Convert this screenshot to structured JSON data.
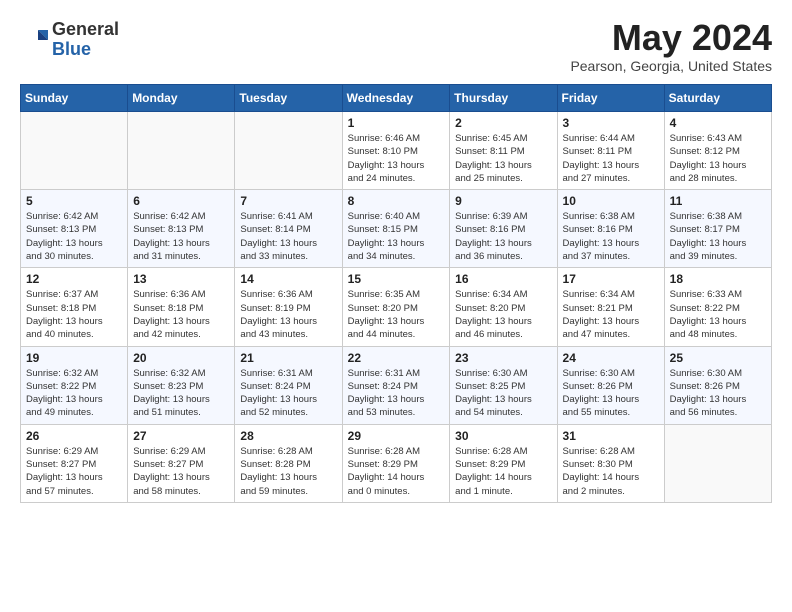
{
  "header": {
    "logo": {
      "general": "General",
      "blue": "Blue"
    },
    "title": "May 2024",
    "location": "Pearson, Georgia, United States"
  },
  "calendar": {
    "days_of_week": [
      "Sunday",
      "Monday",
      "Tuesday",
      "Wednesday",
      "Thursday",
      "Friday",
      "Saturday"
    ],
    "weeks": [
      [
        {
          "day": "",
          "info": ""
        },
        {
          "day": "",
          "info": ""
        },
        {
          "day": "",
          "info": ""
        },
        {
          "day": "1",
          "info": "Sunrise: 6:46 AM\nSunset: 8:10 PM\nDaylight: 13 hours\nand 24 minutes."
        },
        {
          "day": "2",
          "info": "Sunrise: 6:45 AM\nSunset: 8:11 PM\nDaylight: 13 hours\nand 25 minutes."
        },
        {
          "day": "3",
          "info": "Sunrise: 6:44 AM\nSunset: 8:11 PM\nDaylight: 13 hours\nand 27 minutes."
        },
        {
          "day": "4",
          "info": "Sunrise: 6:43 AM\nSunset: 8:12 PM\nDaylight: 13 hours\nand 28 minutes."
        }
      ],
      [
        {
          "day": "5",
          "info": "Sunrise: 6:42 AM\nSunset: 8:13 PM\nDaylight: 13 hours\nand 30 minutes."
        },
        {
          "day": "6",
          "info": "Sunrise: 6:42 AM\nSunset: 8:13 PM\nDaylight: 13 hours\nand 31 minutes."
        },
        {
          "day": "7",
          "info": "Sunrise: 6:41 AM\nSunset: 8:14 PM\nDaylight: 13 hours\nand 33 minutes."
        },
        {
          "day": "8",
          "info": "Sunrise: 6:40 AM\nSunset: 8:15 PM\nDaylight: 13 hours\nand 34 minutes."
        },
        {
          "day": "9",
          "info": "Sunrise: 6:39 AM\nSunset: 8:16 PM\nDaylight: 13 hours\nand 36 minutes."
        },
        {
          "day": "10",
          "info": "Sunrise: 6:38 AM\nSunset: 8:16 PM\nDaylight: 13 hours\nand 37 minutes."
        },
        {
          "day": "11",
          "info": "Sunrise: 6:38 AM\nSunset: 8:17 PM\nDaylight: 13 hours\nand 39 minutes."
        }
      ],
      [
        {
          "day": "12",
          "info": "Sunrise: 6:37 AM\nSunset: 8:18 PM\nDaylight: 13 hours\nand 40 minutes."
        },
        {
          "day": "13",
          "info": "Sunrise: 6:36 AM\nSunset: 8:18 PM\nDaylight: 13 hours\nand 42 minutes."
        },
        {
          "day": "14",
          "info": "Sunrise: 6:36 AM\nSunset: 8:19 PM\nDaylight: 13 hours\nand 43 minutes."
        },
        {
          "day": "15",
          "info": "Sunrise: 6:35 AM\nSunset: 8:20 PM\nDaylight: 13 hours\nand 44 minutes."
        },
        {
          "day": "16",
          "info": "Sunrise: 6:34 AM\nSunset: 8:20 PM\nDaylight: 13 hours\nand 46 minutes."
        },
        {
          "day": "17",
          "info": "Sunrise: 6:34 AM\nSunset: 8:21 PM\nDaylight: 13 hours\nand 47 minutes."
        },
        {
          "day": "18",
          "info": "Sunrise: 6:33 AM\nSunset: 8:22 PM\nDaylight: 13 hours\nand 48 minutes."
        }
      ],
      [
        {
          "day": "19",
          "info": "Sunrise: 6:32 AM\nSunset: 8:22 PM\nDaylight: 13 hours\nand 49 minutes."
        },
        {
          "day": "20",
          "info": "Sunrise: 6:32 AM\nSunset: 8:23 PM\nDaylight: 13 hours\nand 51 minutes."
        },
        {
          "day": "21",
          "info": "Sunrise: 6:31 AM\nSunset: 8:24 PM\nDaylight: 13 hours\nand 52 minutes."
        },
        {
          "day": "22",
          "info": "Sunrise: 6:31 AM\nSunset: 8:24 PM\nDaylight: 13 hours\nand 53 minutes."
        },
        {
          "day": "23",
          "info": "Sunrise: 6:30 AM\nSunset: 8:25 PM\nDaylight: 13 hours\nand 54 minutes."
        },
        {
          "day": "24",
          "info": "Sunrise: 6:30 AM\nSunset: 8:26 PM\nDaylight: 13 hours\nand 55 minutes."
        },
        {
          "day": "25",
          "info": "Sunrise: 6:30 AM\nSunset: 8:26 PM\nDaylight: 13 hours\nand 56 minutes."
        }
      ],
      [
        {
          "day": "26",
          "info": "Sunrise: 6:29 AM\nSunset: 8:27 PM\nDaylight: 13 hours\nand 57 minutes."
        },
        {
          "day": "27",
          "info": "Sunrise: 6:29 AM\nSunset: 8:27 PM\nDaylight: 13 hours\nand 58 minutes."
        },
        {
          "day": "28",
          "info": "Sunrise: 6:28 AM\nSunset: 8:28 PM\nDaylight: 13 hours\nand 59 minutes."
        },
        {
          "day": "29",
          "info": "Sunrise: 6:28 AM\nSunset: 8:29 PM\nDaylight: 14 hours\nand 0 minutes."
        },
        {
          "day": "30",
          "info": "Sunrise: 6:28 AM\nSunset: 8:29 PM\nDaylight: 14 hours\nand 1 minute."
        },
        {
          "day": "31",
          "info": "Sunrise: 6:28 AM\nSunset: 8:30 PM\nDaylight: 14 hours\nand 2 minutes."
        },
        {
          "day": "",
          "info": ""
        }
      ]
    ]
  }
}
